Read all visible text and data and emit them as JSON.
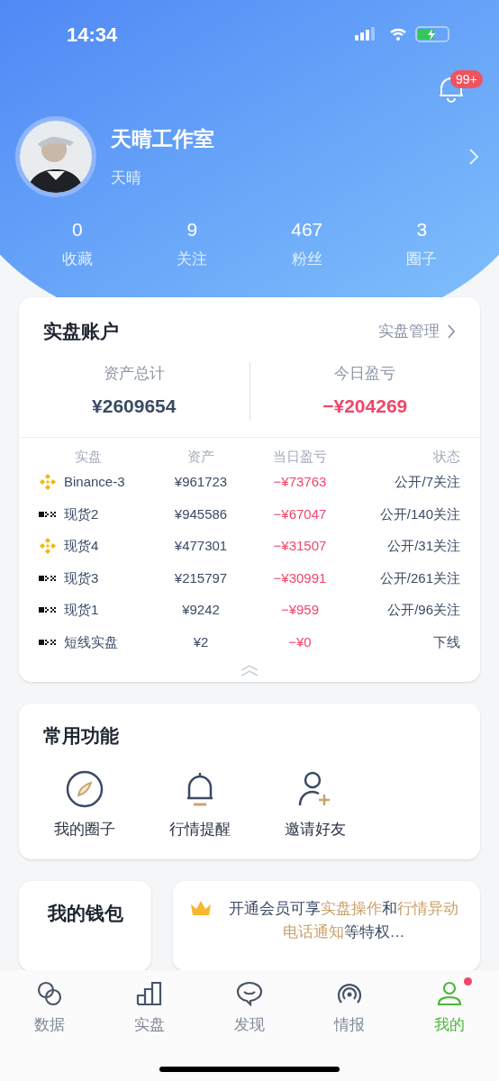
{
  "status_bar": {
    "time": "14:34"
  },
  "notifications": {
    "badge": "99+"
  },
  "profile": {
    "name": "天晴工作室",
    "handle": "天晴"
  },
  "stats": [
    {
      "value": "0",
      "label": "收藏"
    },
    {
      "value": "9",
      "label": "关注"
    },
    {
      "value": "467",
      "label": "粉丝"
    },
    {
      "value": "3",
      "label": "圈子"
    }
  ],
  "account_card": {
    "title": "实盘账户",
    "link": "实盘管理",
    "summary": [
      {
        "label": "资产总计",
        "value": "¥2609654",
        "negative": false
      },
      {
        "label": "今日盈亏",
        "value": "−¥204269",
        "negative": true
      }
    ],
    "columns": [
      "实盘",
      "资产",
      "当日盈亏",
      "状态"
    ],
    "rows": [
      {
        "kind": "binance",
        "name": "Binance-3",
        "assets": "¥961723",
        "pnl": "−¥73763",
        "status": "公开/7关注"
      },
      {
        "kind": "okx",
        "name": "现货2",
        "assets": "¥945586",
        "pnl": "−¥67047",
        "status": "公开/140关注"
      },
      {
        "kind": "binance",
        "name": "现货4",
        "assets": "¥477301",
        "pnl": "−¥31507",
        "status": "公开/31关注"
      },
      {
        "kind": "okx",
        "name": "现货3",
        "assets": "¥215797",
        "pnl": "−¥30991",
        "status": "公开/261关注"
      },
      {
        "kind": "okx",
        "name": "现货1",
        "assets": "¥9242",
        "pnl": "−¥959",
        "status": "公开/96关注"
      },
      {
        "kind": "okx",
        "name": "短线实盘",
        "assets": "¥2",
        "pnl": "−¥0",
        "status": "下线"
      }
    ]
  },
  "features": {
    "title": "常用功能",
    "items": [
      {
        "kind": "compass",
        "label": "我的圈子"
      },
      {
        "kind": "bell",
        "label": "行情提醒"
      },
      {
        "kind": "invite",
        "label": "邀请好友"
      }
    ]
  },
  "wallet": {
    "title": "我的钱包"
  },
  "promo": {
    "segments": [
      {
        "text": "开通会员可享",
        "highlight": false
      },
      {
        "text": "实盘操作",
        "highlight": true
      },
      {
        "text": "和",
        "highlight": false
      },
      {
        "text": "行情异动电话通知",
        "highlight": true
      },
      {
        "text": "等特权…",
        "highlight": false
      }
    ]
  },
  "tabs": [
    {
      "kind": "data",
      "label": "数据",
      "selected": false,
      "dot": false
    },
    {
      "kind": "chart",
      "label": "实盘",
      "selected": false,
      "dot": false
    },
    {
      "kind": "chat",
      "label": "发现",
      "selected": false,
      "dot": false
    },
    {
      "kind": "signal",
      "label": "情报",
      "selected": false,
      "dot": false
    },
    {
      "kind": "user",
      "label": "我的",
      "selected": true,
      "dot": true
    }
  ]
}
